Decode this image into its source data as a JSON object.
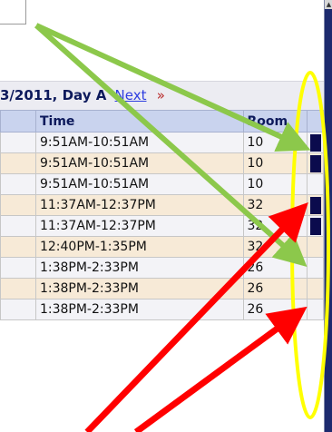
{
  "header": {
    "date_text": "3/2011, Day A",
    "next_label": "Next",
    "next_chevron": "»"
  },
  "table": {
    "columns": [
      "",
      "Time",
      "Room",
      ""
    ],
    "rows": [
      {
        "time": "9:51AM-10:51AM",
        "room": "10",
        "flag": true
      },
      {
        "time": "9:51AM-10:51AM",
        "room": "10",
        "flag": true
      },
      {
        "time": "9:51AM-10:51AM",
        "room": "10",
        "flag": false
      },
      {
        "time": "11:37AM-12:37PM",
        "room": "32",
        "flag": true
      },
      {
        "time": "11:37AM-12:37PM",
        "room": "32",
        "flag": true
      },
      {
        "time": "12:40PM-1:35PM",
        "room": "32",
        "flag": false
      },
      {
        "time": "1:38PM-2:33PM",
        "room": "26",
        "flag": false
      },
      {
        "time": "1:38PM-2:33PM",
        "room": "26",
        "flag": false
      },
      {
        "time": "1:38PM-2:33PM",
        "room": "26",
        "flag": false
      }
    ]
  },
  "colors": {
    "green_arrow": "#8cc84b",
    "red_arrow": "#ff0000",
    "yellow_ellipse": "#ffff00",
    "scrollbar": "#1c2a6e",
    "flag": "#0b0b4d"
  },
  "icons": {
    "scroll_up": "scroll-up-arrow-icon",
    "green_arrow": "arrow-icon",
    "red_arrow": "arrow-icon"
  }
}
